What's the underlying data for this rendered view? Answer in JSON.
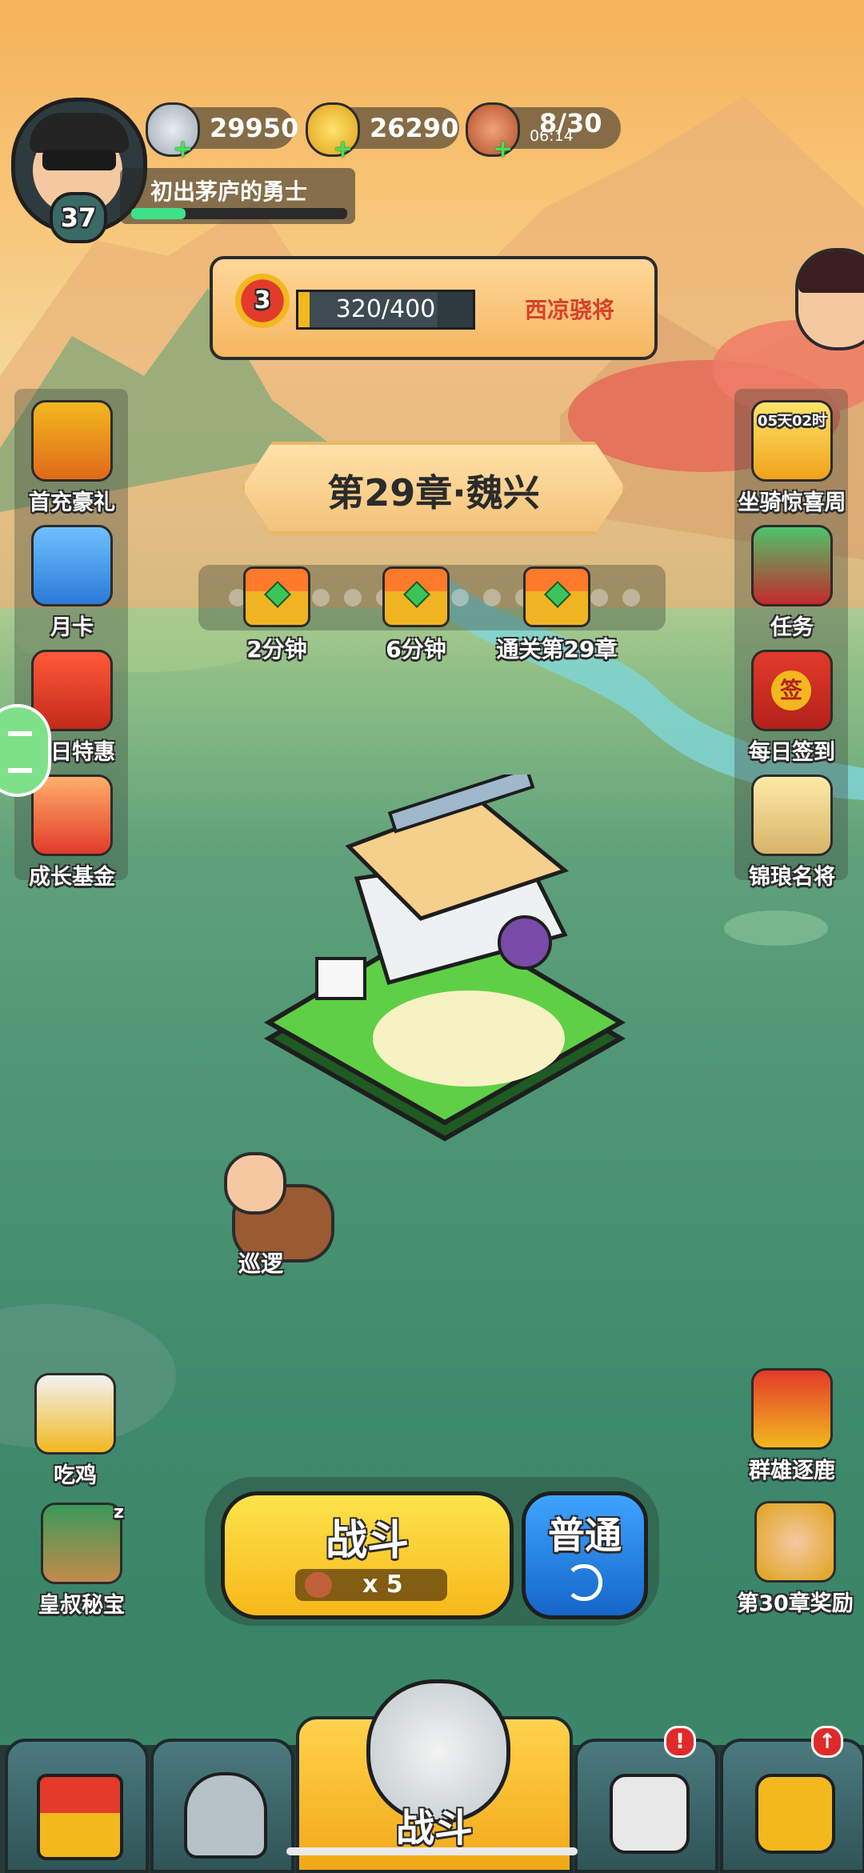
{
  "player": {
    "level": "37",
    "title": "初出茅庐的勇士",
    "exp_progress": 0.25
  },
  "resources": {
    "silver": "29950",
    "gold": "26290",
    "stamina": "8/30",
    "stamina_timer": "06:14"
  },
  "rank_banner": {
    "rank": "3",
    "progress_text": "320/400",
    "progress": 0.8,
    "rank_name": "西凉骁将"
  },
  "chapter": {
    "title": "第29章·魏兴"
  },
  "chapter_rewards": [
    {
      "label": "2分钟",
      "icon": "chest-icon"
    },
    {
      "label": "6分钟",
      "icon": "chest-icon"
    },
    {
      "label": "通关第29章",
      "icon": "chest-icon"
    }
  ],
  "left_menu": [
    {
      "label": "首充豪礼",
      "icon": "gift-chest-icon"
    },
    {
      "label": "月卡",
      "icon": "month-card-icon"
    },
    {
      "label": "每日特惠",
      "icon": "gift-bag-icon"
    },
    {
      "label": "成长基金",
      "icon": "fund-icon"
    }
  ],
  "right_menu": [
    {
      "label": "坐骑惊喜周",
      "icon": "mount-icon",
      "timer": "05天02时"
    },
    {
      "label": "任务",
      "icon": "task-scroll-icon"
    },
    {
      "label": "每日签到",
      "icon": "sign-in-icon",
      "stamp": "签"
    },
    {
      "label": "锦琅名将",
      "icon": "general-icon"
    }
  ],
  "patrol": {
    "label": "巡逻"
  },
  "bottom_left": [
    {
      "label": "吃鸡",
      "icon": "chicken-icon"
    },
    {
      "label": "皇叔秘宝",
      "icon": "treasure-icon",
      "zzz": "z"
    }
  ],
  "bottom_right": [
    {
      "label": "群雄逐鹿",
      "icon": "banner-icon"
    },
    {
      "label": "第30章奖励",
      "icon": "hero-reward-icon"
    }
  ],
  "battle": {
    "label": "战斗",
    "cost": "x 5",
    "mode_label": "普通",
    "mode_icon": "refresh-icon"
  },
  "nav_tabs": [
    {
      "name": "city",
      "icon": "city-gate-icon"
    },
    {
      "name": "heroes",
      "icon": "helmet-icon"
    },
    {
      "name": "battle",
      "label": "战斗",
      "icon": "crossed-swords-icon"
    },
    {
      "name": "equipment",
      "icon": "weapon-icon",
      "badge": "!"
    },
    {
      "name": "upgrade",
      "icon": "upgrade-fist-icon",
      "badge": "↑"
    }
  ],
  "colors": {
    "accent_gold": "#f2b81e",
    "battle_button": "#f7cf2a",
    "mode_button": "#1a7ad8",
    "exp_bar": "#3ee08a"
  }
}
